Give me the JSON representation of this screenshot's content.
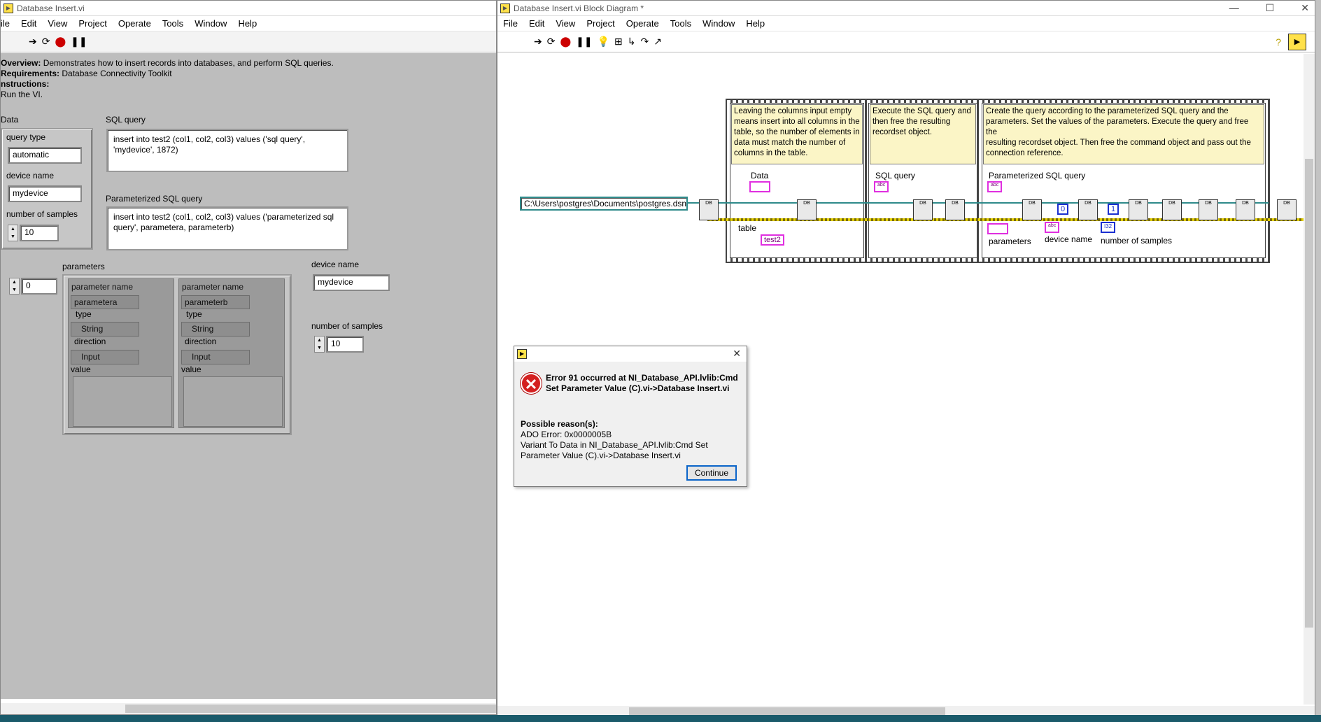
{
  "front": {
    "title": "Database Insert.vi",
    "menus": [
      "ile",
      "Edit",
      "View",
      "Project",
      "Operate",
      "Tools",
      "Window",
      "Help"
    ],
    "overview_label": "Overview:",
    "overview_text": " Demonstrates how to insert records into databases, and perform SQL queries.",
    "requirements_label": "Requirements:",
    "requirements_text": " Database Connectivity Toolkit",
    "instructions_label": "nstructions:",
    "run_text": "Run the VI.",
    "data_label": "Data",
    "query_type_label": "query type",
    "query_type_value": "automatic",
    "device_name_label": "device name",
    "device_name_value": "mydevice",
    "num_samples_label": "number of samples",
    "num_samples_value": "10",
    "sql_query_label": "SQL query",
    "sql_query_value": "insert into test2 (col1, col2, col3) values ('sql query',\n'mydevice', 1872)",
    "param_sql_label": "Parameterized SQL query",
    "param_sql_value": "insert into test2 (col1, col2, col3) values ('parameterized sql\nquery', parametera, parameterb)",
    "parameters_label": "parameters",
    "index_value": "0",
    "param_cols": [
      {
        "name_label": "parameter name",
        "name": "parametera",
        "type_label": "type",
        "type": "String",
        "dir_label": "direction",
        "dir": "Input",
        "value_label": "value"
      },
      {
        "name_label": "parameter name",
        "name": "parameterb",
        "type_label": "type",
        "type": "String",
        "dir_label": "direction",
        "dir": "Input",
        "value_label": "value"
      }
    ],
    "device_name2_label": "device name",
    "device_name2_value": "mydevice",
    "num_samples2_label": "number of samples",
    "num_samples2_value": "10"
  },
  "diagram": {
    "title": "Database Insert.vi Block Diagram *",
    "menus": [
      "File",
      "Edit",
      "View",
      "Project",
      "Operate",
      "Tools",
      "Window",
      "Help"
    ],
    "path": "C:\\Users\\postgres\\Documents\\postgres.dsn",
    "comment1": "Leaving the columns input empty\nmeans insert into all columns in the\ntable, so the number of elements in\ndata must match the number of\ncolumns in the table.",
    "comment2": "Execute the SQL query and\nthen free the resulting\nrecordset object.",
    "comment3": "Create the query according to the parameterized SQL query and the\nparameters. Set the values of the parameters. Execute the query and free the\nresulting recordset object.  Then free the command object and pass out the\nconnection reference.",
    "data_label": "Data",
    "table_label": "table",
    "table_value": "test2",
    "sql_label": "SQL query",
    "psql_label": "Parameterized SQL query",
    "parameters_label": "parameters",
    "device_label": "device name",
    "samples_label": "number of samples",
    "const0": "0",
    "const1": "1",
    "i32": "I32",
    "abc": "abc",
    "db": "DB"
  },
  "dialog": {
    "heading": "Error 91 occurred at NI_Database_API.lvlib:Cmd\nSet Parameter Value (C).vi->Database Insert.vi",
    "reason_label": "Possible reason(s):",
    "reason_text": "ADO Error: 0x0000005B\nVariant To Data in NI_Database_API.lvlib:Cmd Set\nParameter Value (C).vi->Database Insert.vi",
    "continue": "Continue"
  }
}
